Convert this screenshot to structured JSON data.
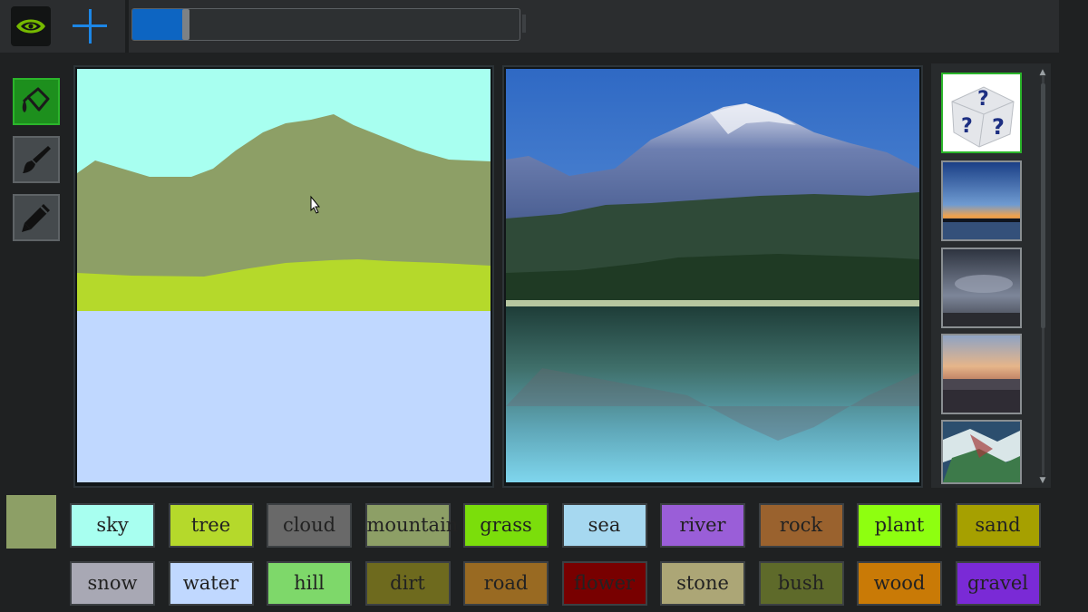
{
  "progress_fraction": 0.14,
  "drawing": {
    "colors": {
      "sky": "#a8fff0",
      "mountain": "#8d9f66",
      "grass": "#b5d92b",
      "water": "#c0d8ff"
    }
  },
  "thumbnails": [
    {
      "icon": "dice-question-icon",
      "selected": true
    },
    {
      "icon": "sunset-lake-thumbnail",
      "selected": false
    },
    {
      "icon": "cloudy-sky-thumbnail",
      "selected": false
    },
    {
      "icon": "city-sunset-thumbnail",
      "selected": false
    },
    {
      "icon": "abstract-painting-thumbnail",
      "selected": false
    }
  ],
  "current_color": "#8d9f66",
  "labels": [
    {
      "label": "sky",
      "color": "#a8fff0"
    },
    {
      "label": "tree",
      "color": "#b5d92b"
    },
    {
      "label": "cloud",
      "color": "#696969"
    },
    {
      "label": "mountain",
      "color": "#8d9f66"
    },
    {
      "label": "grass",
      "color": "#7bde0b"
    },
    {
      "label": "sea",
      "color": "#a6d8f0"
    },
    {
      "label": "river",
      "color": "#9a5ed8"
    },
    {
      "label": "rock",
      "color": "#9a622e"
    },
    {
      "label": "plant",
      "color": "#8eff10"
    },
    {
      "label": "sand",
      "color": "#a6a000"
    },
    {
      "label": "snow",
      "color": "#a8a8b4"
    },
    {
      "label": "water",
      "color": "#c0d8ff"
    },
    {
      "label": "hill",
      "color": "#7ed86a"
    },
    {
      "label": "dirt",
      "color": "#6e6a1e"
    },
    {
      "label": "road",
      "color": "#996a22"
    },
    {
      "label": "flower",
      "color": "#780000"
    },
    {
      "label": "stone",
      "color": "#aca676"
    },
    {
      "label": "bush",
      "color": "#5e6a2a"
    },
    {
      "label": "wood",
      "color": "#c97a06"
    },
    {
      "label": "gravel",
      "color": "#7a2ad6"
    }
  ]
}
